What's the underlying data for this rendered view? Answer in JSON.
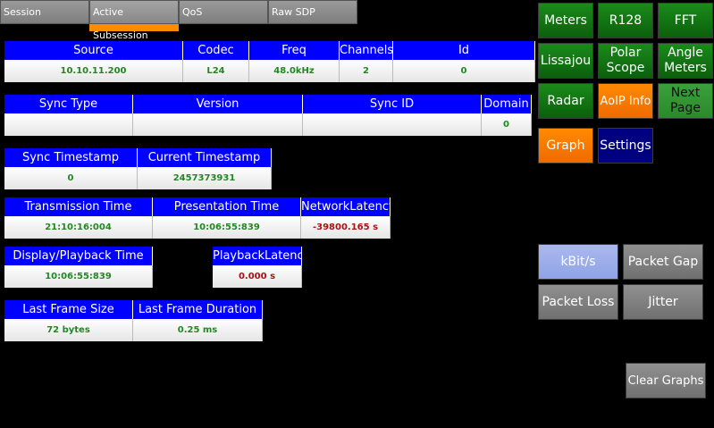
{
  "tabs": [
    "Session",
    "Active Subsession",
    "QoS",
    "Raw SDP"
  ],
  "stream": {
    "headers": [
      "Source",
      "Codec",
      "Freq",
      "Channels",
      "Id"
    ],
    "values": [
      "10.10.11.200",
      "L24",
      "48.0kHz",
      "2",
      "0"
    ]
  },
  "sync": {
    "headers": [
      "Sync Type",
      "Version",
      "Sync ID",
      "Domain"
    ],
    "values": [
      "",
      "",
      "",
      "0"
    ]
  },
  "timestamps": {
    "headers": [
      "Sync Timestamp",
      "Current Timestamp"
    ],
    "values": [
      "0",
      "2457373931"
    ]
  },
  "timing": {
    "headers": [
      "Transmission Time",
      "Presentation Time",
      "NetworkLatency"
    ],
    "values": [
      "21:10:16:004",
      "10:06:55:839",
      "-39800.165 s"
    ]
  },
  "display": {
    "header": "Display/Playback Time",
    "value": "10:06:55:839"
  },
  "playback": {
    "header": "PlaybackLatency",
    "value": "0.000 s"
  },
  "frame": {
    "headers": [
      "Last Frame Size",
      "Last Frame Duration"
    ],
    "values": [
      "72 bytes",
      "0.25 ms"
    ]
  },
  "buttons": {
    "meters": "Meters",
    "r128": "R128",
    "fft": "FFT",
    "lissajou": "Lissajou",
    "polar_line1": "Polar",
    "polar_line2": "Scope",
    "angle_line1": "Angle",
    "angle_line2": "Meters",
    "radar": "Radar",
    "aoip": "AoIP Info",
    "next_line1": "Next",
    "next_line2": "Page",
    "graph": "Graph",
    "settings": "Settings"
  },
  "graph_buttons": {
    "kbits": "kBit/s",
    "packet_gap": "Packet Gap",
    "packet_loss": "Packet Loss",
    "jitter": "Jitter"
  },
  "clear_graphs": "Clear Graphs",
  "colors": {
    "header_blue": "#0000ff",
    "value_green": "#228822",
    "value_red": "#aa1111",
    "accent_orange": "#ff8c00"
  }
}
